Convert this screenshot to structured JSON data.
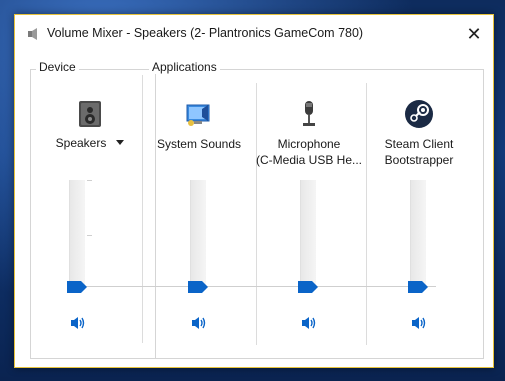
{
  "window": {
    "title": "Volume Mixer - Speakers (2- Plantronics GameCom 780)",
    "close_glyph": "✕"
  },
  "device": {
    "group_label": "Device",
    "name": "Speakers",
    "icon": "speaker-box-icon",
    "volume_percent": 0
  },
  "applications": {
    "group_label": "Applications",
    "items": [
      {
        "name": "System Sounds",
        "icon": "system-sounds-icon",
        "volume_percent": 0
      },
      {
        "name": "Microphone\n(C-Media USB He...",
        "name_line1": "Microphone",
        "name_line2": "(C-Media USB He...",
        "icon": "microphone-icon",
        "volume_percent": 0
      },
      {
        "name_line1": "Steam Client",
        "name_line2": "Bootstrapper",
        "icon": "steam-icon",
        "volume_percent": 0
      }
    ]
  },
  "colors": {
    "accent": "#0a64c8",
    "window_border": "#e6c23a",
    "desktop": "#123a7a"
  }
}
